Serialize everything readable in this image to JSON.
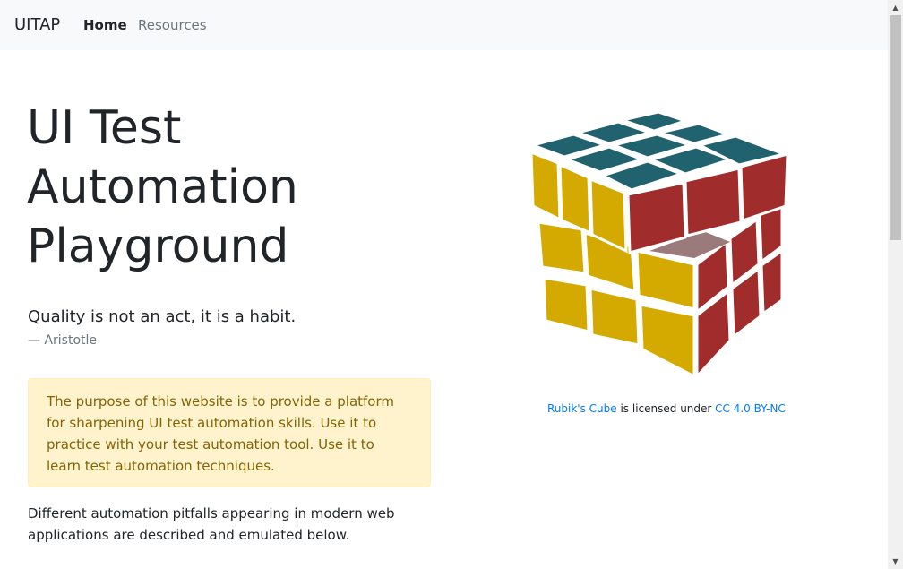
{
  "navbar": {
    "brand": "UITAP",
    "items": [
      {
        "label": "Home"
      },
      {
        "label": "Resources"
      }
    ]
  },
  "hero": {
    "title": "UI Test Automation Playground",
    "quote": "Quality is not an act, it is a habit.",
    "quote_author": "— Aristotle"
  },
  "alert": {
    "text": "The purpose of this website is to provide a platform for sharpening UI test automation skills. Use it to practice with your test automation tool. Use it to learn test automation techniques."
  },
  "description": "Different automation pitfalls appearing in modern web applications are described and emulated below.",
  "image_credit": {
    "link_text": "Rubik's Cube",
    "middle_text": " is licensed under ",
    "license_text": "CC 4.0 BY-NC"
  },
  "colors": {
    "cube_top": "#20636f",
    "cube_front": "#d4aa00",
    "cube_right": "#a02c2c",
    "alert_bg": "#fff3cd",
    "alert_text": "#856404",
    "link": "#007bff"
  },
  "icons": {
    "cube_image": "rubiks-cube-image",
    "scroll_up": "scroll-up-arrow-icon",
    "scroll_down": "scroll-down-arrow-icon"
  }
}
